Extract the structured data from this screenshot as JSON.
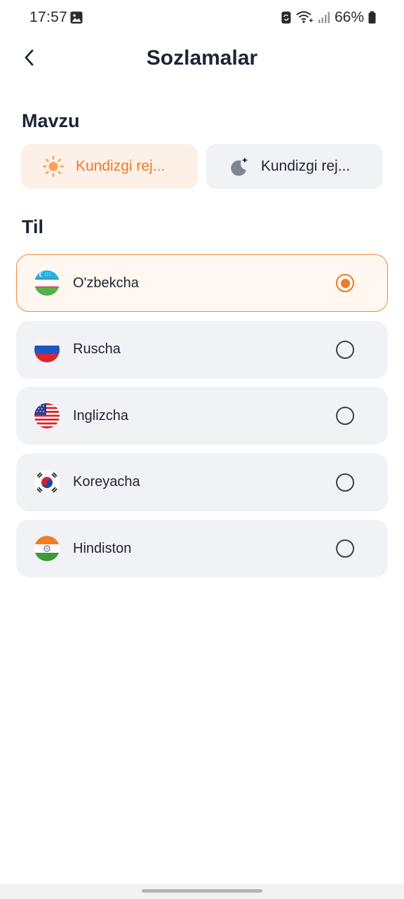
{
  "status_bar": {
    "time": "17:57",
    "battery_percent": "66%",
    "icons": [
      "gallery-icon",
      "sync-icon",
      "wifi-icon",
      "signal-icon",
      "battery-icon"
    ]
  },
  "header": {
    "title": "Sozlamalar",
    "back_icon": "chevron-left-icon"
  },
  "theme_section": {
    "title": "Mavzu",
    "options": [
      {
        "label": "Kundizgi rej...",
        "icon": "sun-icon",
        "active": true
      },
      {
        "label": "Kundizgi rej...",
        "icon": "moon-icon",
        "active": false
      }
    ]
  },
  "language_section": {
    "title": "Til",
    "items": [
      {
        "label": "O'zbekcha",
        "flag": "uzbekistan-flag-icon",
        "selected": true
      },
      {
        "label": "Ruscha",
        "flag": "russia-flag-icon",
        "selected": false
      },
      {
        "label": "Inglizcha",
        "flag": "usa-flag-icon",
        "selected": false
      },
      {
        "label": "Koreyacha",
        "flag": "south-korea-flag-icon",
        "selected": false
      },
      {
        "label": "Hindiston",
        "flag": "india-flag-icon",
        "selected": false
      }
    ]
  },
  "colors": {
    "accent": "#ec7a2c",
    "text": "#1d2433",
    "card_bg": "#f1f2f6",
    "active_bg": "#fdf1e7"
  }
}
